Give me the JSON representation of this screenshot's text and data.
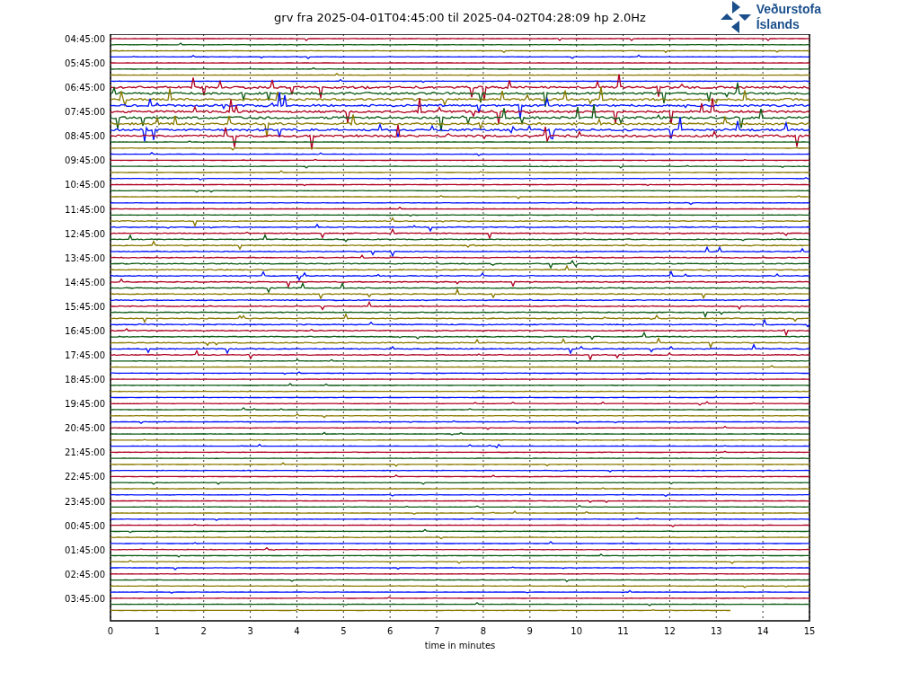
{
  "title": "grv fra 2025-04-01T04:45:00 til 2025-04-02T04:28:09 hp 2.0Hz",
  "logo": {
    "line_1": "Veðurstofa",
    "line_2": "Íslands"
  },
  "y_labels": [
    "04:45:00",
    "05:45:00",
    "06:45:00",
    "07:45:00",
    "08:45:00",
    "09:45:00",
    "10:45:00",
    "11:45:00",
    "12:45:00",
    "13:45:00",
    "14:45:00",
    "15:45:00",
    "16:45:00",
    "17:45:00",
    "18:45:00",
    "19:45:00",
    "20:45:00",
    "21:45:00",
    "22:45:00",
    "23:45:00",
    "00:45:00",
    "01:45:00",
    "02:45:00",
    "03:45:00"
  ],
  "x_ticks": [
    "0",
    "1",
    "2",
    "3",
    "4",
    "5",
    "6",
    "7",
    "8",
    "9",
    "10",
    "11",
    "12",
    "13",
    "14",
    "15"
  ],
  "xlabel": "time in minutes"
}
